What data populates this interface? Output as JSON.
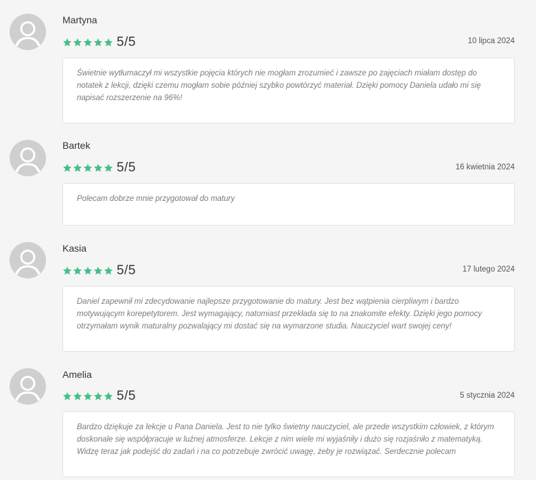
{
  "colors": {
    "star": "#44bf8a",
    "avatar": "#cfcfcf"
  },
  "reviews": [
    {
      "author": "Martyna",
      "rating_value": 5,
      "rating_text": "5/5",
      "date": "10 lipca 2024",
      "text": "Świetnie wytłumaczył mi wszystkie pojęcia których nie mogłam zrozumieć i zawsze po zajęciach miałam dostęp do notatek z lekcji, dzięki czemu mogłam sobie później szybko powtórzyć materiał. Dzięki pomocy Daniela udało mi się napisać rozszerzenie na 96%!"
    },
    {
      "author": "Bartek",
      "rating_value": 5,
      "rating_text": "5/5",
      "date": "16 kwietnia 2024",
      "text": "Polecam dobrze mnie przygotował do matury"
    },
    {
      "author": "Kasia",
      "rating_value": 5,
      "rating_text": "5/5",
      "date": "17 lutego 2024",
      "text": "Daniel zapewnił mi zdecydowanie najlepsze przygotowanie do matury. Jest bez wątpienia cierpliwym i bardzo motywującym korepetytorem. Jest wymagający, natomiast przekłada się to na znakomite efekty. Dzięki jego pomocy otrzymałam wynik maturalny pozwalający mi dostać się na wymarzone studia. Nauczyciel wart swojej ceny!"
    },
    {
      "author": "Amelia",
      "rating_value": 5,
      "rating_text": "5/5",
      "date": "5 stycznia 2024",
      "text": "Bardzo dziękuje za lekcje u Pana Daniela. Jest to nie tylko świetny nauczyciel, ale przede wszystkim człowiek, z którym doskonale się współpracuje w luźnej atmosferze. Lekcje z nim wiele mi wyjaśniły i dużo się rozjaśniło z matematyką. Widzę teraz jak podejść do zadań i na co potrzebuje zwrócić uwagę, żeby je rozwiązać. Serdecznie polecam"
    }
  ]
}
